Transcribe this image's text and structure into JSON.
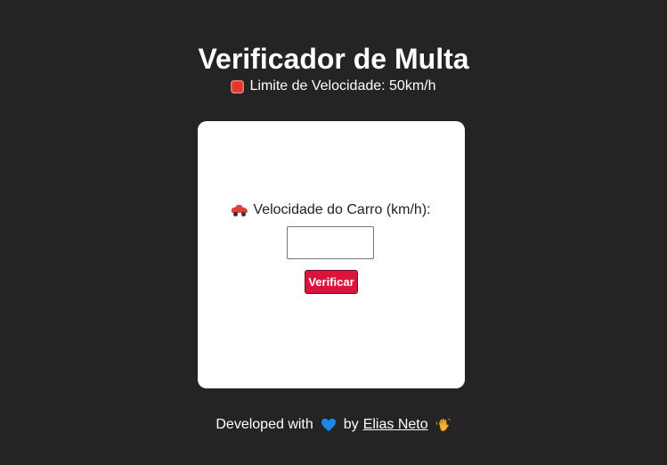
{
  "header": {
    "title": "Verificador de Multa",
    "speed_limit_text": "Limite de Velocidade: 50km/h",
    "limit_icon": "stop-sign-icon"
  },
  "form": {
    "label": "Velocidade do Carro (km/h):",
    "label_icon": "car-icon",
    "speed_input": {
      "value": "",
      "placeholder": ""
    },
    "submit_label": "Verificar",
    "button_color": "#dc143c"
  },
  "footer": {
    "prefix": "Developed with",
    "heart_icon": "blue-heart-icon",
    "by": "by",
    "author": "Elias Neto",
    "wave_icon": "waving-hand-icon"
  },
  "colors": {
    "background": "#252324",
    "card": "#ffffff",
    "accent": "#dc143c"
  }
}
